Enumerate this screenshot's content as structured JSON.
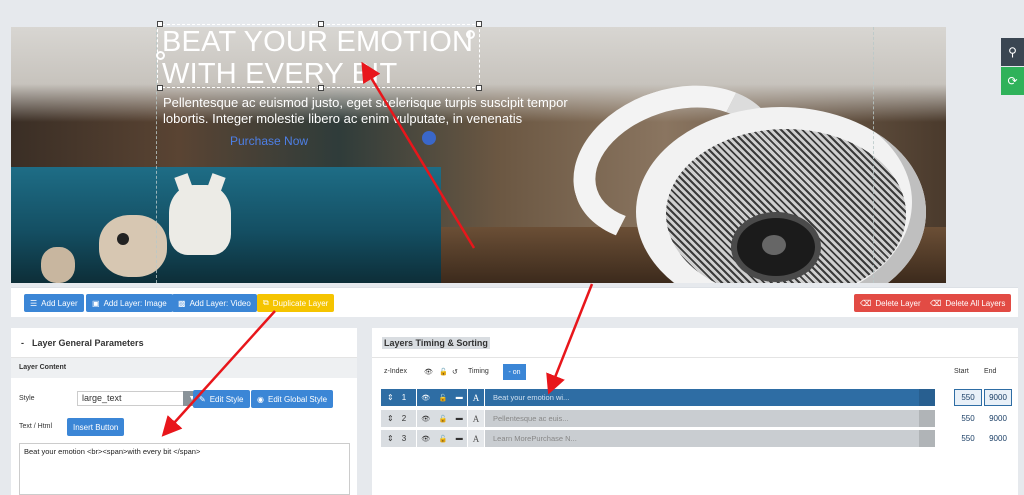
{
  "slide": {
    "title_line1": "BEAT YOUR EMOTION",
    "title_line2": "WITH EVERY BIT",
    "subtitle_line1": "Pellentesque ac euismod justo, eget scelerisque turpis suscipit tempor",
    "subtitle_line2": "lobortis. Integer molestie libero ac enim vulputate, in venenatis",
    "link_text": "Purchase Now"
  },
  "toolbar": {
    "add_layer": "Add Layer",
    "add_layer_image": "Add Layer: Image",
    "add_layer_video": "Add Layer: Video",
    "duplicate_layer": "Duplicate Layer",
    "delete_layer": "Delete Layer",
    "delete_all_layers": "Delete All Layers"
  },
  "left_panel": {
    "title": "Layer General Parameters",
    "collapse_symbol": "-",
    "section": "Layer Content",
    "style_label": "Style",
    "style_value": "large_text",
    "edit_style": "Edit Style",
    "edit_global_style": "Edit Global Style",
    "text_html_label": "Text / Html",
    "insert_button": "Insert Button",
    "text_value": "Beat your emotion <br><span>with every bit </span>"
  },
  "right_panel": {
    "title": "Layers Timing & Sorting",
    "col_zindex": "z-Index",
    "col_timing": "Timing",
    "on_label": "- on",
    "col_start": "Start",
    "col_end": "End",
    "rows": [
      {
        "z": "1",
        "name": "Beat your emotion wi...",
        "start": "550",
        "end": "9000"
      },
      {
        "z": "2",
        "name": "Pellentesque ac euis...",
        "start": "550",
        "end": "9000"
      },
      {
        "z": "3",
        "name": "Learn MorePurchase N...",
        "start": "550",
        "end": "9000"
      }
    ]
  },
  "colors": {
    "primary_blue": "#3b86d6",
    "duplicate_yellow": "#f5c400",
    "delete_red": "#e24b44",
    "active_row": "#2e6da4",
    "annotation_arrow": "#e8161b"
  },
  "icons": [
    "layers-icon",
    "image-icon",
    "video-icon",
    "copy-icon",
    "trash-icon",
    "pencil-icon",
    "eye-icon",
    "lock-icon",
    "history-icon",
    "sort-icon",
    "search-icon",
    "refresh-icon"
  ]
}
